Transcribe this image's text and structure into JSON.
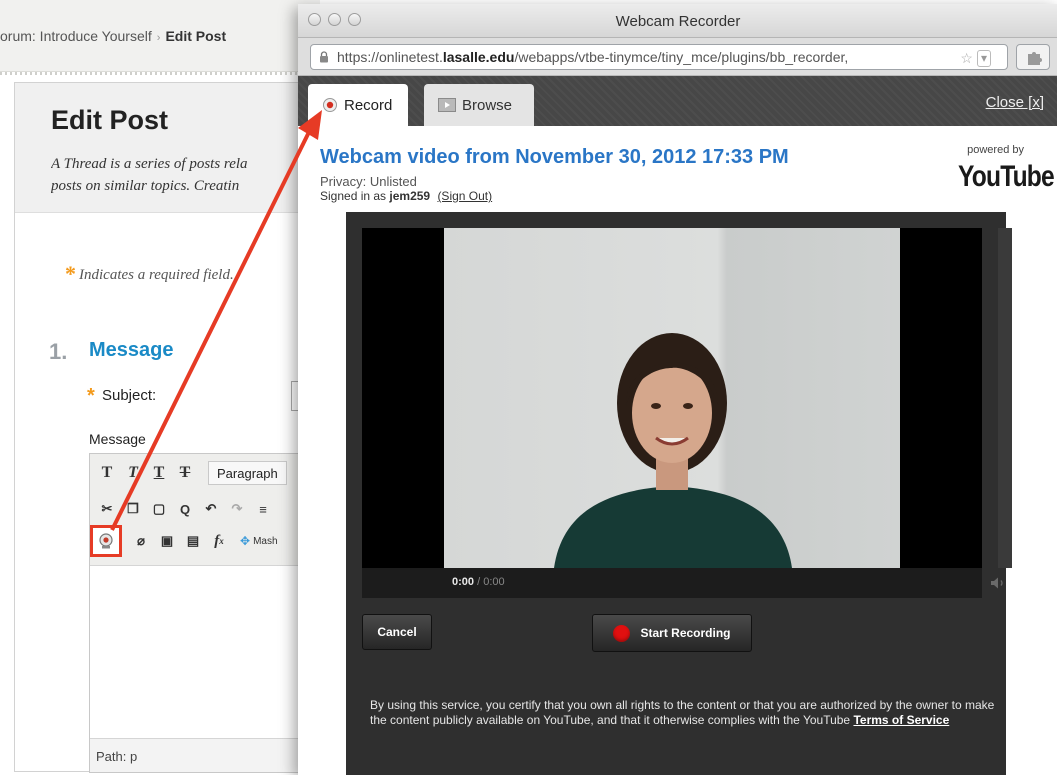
{
  "background_page": {
    "breadcrumb": {
      "forum": "orum: Introduce Yourself",
      "separator": "›",
      "current": "Edit Post"
    },
    "title": "Edit Post",
    "description_line1": "A Thread is a series of posts rela",
    "description_line2": "posts on similar topics. Creatin",
    "required_note": "Indicates a required field.",
    "step_number": "1.",
    "step_title": "Message",
    "subject_label": "Subject:",
    "message_label": "Message",
    "toolbar": {
      "paragraph": "Paragraph",
      "mashups": "Mash"
    },
    "path_label": "Path: p"
  },
  "popup": {
    "window_title": "Webcam Recorder",
    "url": {
      "prefix": "https://onlinetest.",
      "domain": "lasalle.edu",
      "suffix": "/webapps/vtbe-tinymce/tiny_mce/plugins/bb_recorder,"
    },
    "tabs": [
      {
        "label": "Record",
        "active": true
      },
      {
        "label": "Browse",
        "active": false
      }
    ],
    "close_label": "Close [x]",
    "video_title": "Webcam video from November 30, 2012 17:33 PM",
    "privacy": "Privacy: Unlisted",
    "signed_in_prefix": "Signed in as",
    "username": "jem259",
    "sign_out": "(Sign Out)",
    "powered_by": "powered by",
    "youtube_logo": "YouTube",
    "time_current": "0:00",
    "time_separator": " / ",
    "time_total": "0:00",
    "cancel_label": "Cancel",
    "start_label": "Start Recording",
    "legal_text": "By using this service, you certify that you own all rights to the content or that you are authorized by the owner to make the content publicly available on YouTube, and that it otherwise complies with the YouTube",
    "terms_link": "Terms of Service"
  },
  "colors": {
    "accent_blue": "#2a76c6",
    "annotation_red": "#e63b25",
    "record_red": "#e11010",
    "required_orange": "#f39a1c"
  }
}
